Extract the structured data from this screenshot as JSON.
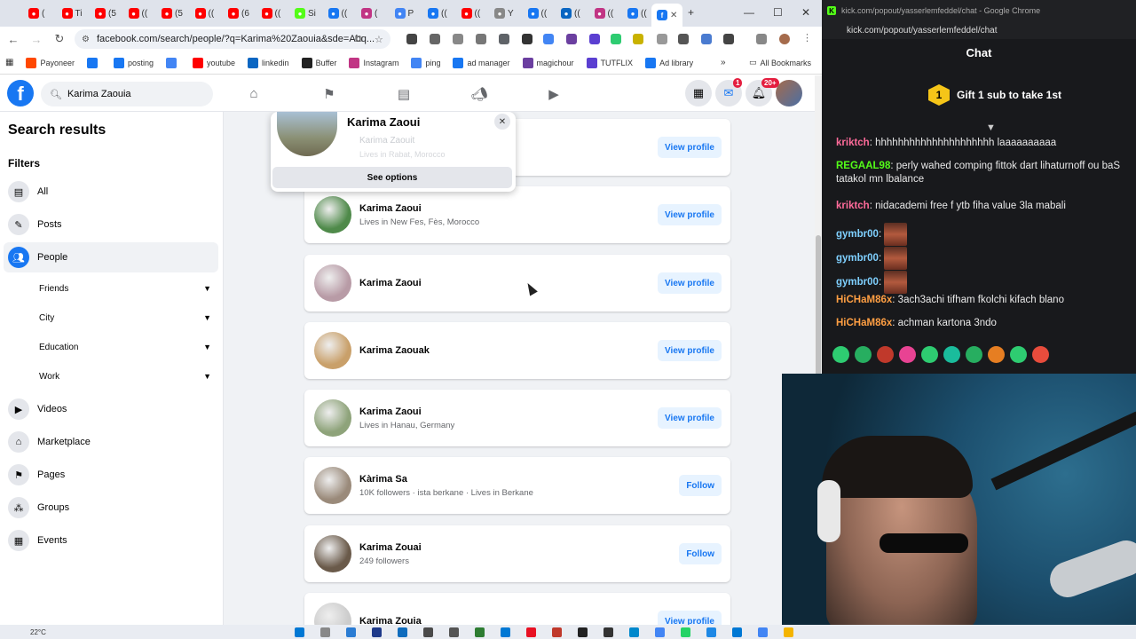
{
  "browser": {
    "tabs": [
      {
        "label": "(",
        "color": "#ff0000"
      },
      {
        "label": "Ti",
        "color": "#ff0000"
      },
      {
        "label": "(5",
        "color": "#ff0000"
      },
      {
        "label": "((",
        "color": "#ff0000"
      },
      {
        "label": "(5",
        "color": "#ff0000"
      },
      {
        "label": "((",
        "color": "#ff0000"
      },
      {
        "label": "(6",
        "color": "#ff0000"
      },
      {
        "label": "((",
        "color": "#ff0000"
      },
      {
        "label": "Si",
        "color": "#53fc18"
      },
      {
        "label": "((",
        "color": "#1877f2"
      },
      {
        "label": "(",
        "color": "#c13584"
      },
      {
        "label": "P",
        "color": "#4285f4"
      },
      {
        "label": "((",
        "color": "#1877f2"
      },
      {
        "label": "((",
        "color": "#ff0000"
      },
      {
        "label": "Y",
        "color": "#888888"
      },
      {
        "label": "((",
        "color": "#1877f2"
      },
      {
        "label": "((",
        "color": "#0a66c2"
      },
      {
        "label": "((",
        "color": "#c13584"
      },
      {
        "label": "((",
        "color": "#1877f2"
      }
    ],
    "new_tab": "+",
    "url": "facebook.com/search/people/?q=Karima%20Zaouia&sde=Abq...",
    "bookmarks": [
      {
        "label": "Payoneer",
        "color": "#ff4800"
      },
      {
        "label": "",
        "color": "#1877f2"
      },
      {
        "label": "posting",
        "color": "#1877f2"
      },
      {
        "label": "",
        "color": "#4285f4"
      },
      {
        "label": "youtube",
        "color": "#ff0000"
      },
      {
        "label": "linkedin",
        "color": "#0a66c2"
      },
      {
        "label": "Buffer",
        "color": "#222222"
      },
      {
        "label": "Instagram",
        "color": "#c13584"
      },
      {
        "label": "ping",
        "color": "#4285f4"
      },
      {
        "label": "ad manager",
        "color": "#1877f2"
      },
      {
        "label": "magichour",
        "color": "#6b3fa0"
      },
      {
        "label": "TUTFLIX",
        "color": "#5b3fd1"
      },
      {
        "label": "Ad library",
        "color": "#1877f2"
      }
    ],
    "more_bookmarks": "»",
    "all_bookmarks": "All Bookmarks"
  },
  "fb": {
    "search_value": "Karima Zaouia",
    "messenger_badge": "1",
    "notif_badge": "20+"
  },
  "sidebar": {
    "title": "Search results",
    "filters_label": "Filters",
    "items": [
      {
        "label": "All",
        "icon": "feed-icon"
      },
      {
        "label": "Posts",
        "icon": "posts-icon"
      },
      {
        "label": "People",
        "icon": "people-icon"
      }
    ],
    "people_sub": [
      "Friends",
      "City",
      "Education",
      "Work"
    ],
    "more_items": [
      {
        "label": "Videos",
        "icon": "video-icon"
      },
      {
        "label": "Marketplace",
        "icon": "marketplace-icon"
      },
      {
        "label": "Pages",
        "icon": "pages-icon"
      },
      {
        "label": "Groups",
        "icon": "groups-icon"
      },
      {
        "label": "Events",
        "icon": "events-icon"
      }
    ]
  },
  "popup": {
    "name": "Karima Zaoui",
    "ghost_name": "Karima Zaouit",
    "ghost_sub": "Lives in Rabat, Morocco",
    "options": "See options"
  },
  "results": [
    {
      "name": "",
      "sub": "",
      "action": "View profile",
      "color": "#7a8a6a"
    },
    {
      "name": "Karima Zaoui",
      "sub": "Lives in New Fes, Fès, Morocco",
      "action": "View profile",
      "color": "#4f8a4a"
    },
    {
      "name": "Karima Zaoui",
      "sub": "",
      "action": "View profile",
      "color": "#b89ba6"
    },
    {
      "name": "Karima Zaouak",
      "sub": "",
      "action": "View profile",
      "color": "#c9a06a"
    },
    {
      "name": "Karima Zaoui",
      "sub": "Lives in Hanau, Germany",
      "action": "View profile",
      "color": "#8ea37a"
    },
    {
      "name": "Kàrima Sa",
      "sub": "10K followers · ista berkane · Lives in Berkane",
      "action": "Follow",
      "color": "#9a8a7a"
    },
    {
      "name": "Karima Zouai",
      "sub": "249 followers",
      "action": "Follow",
      "color": "#6a5a4a"
    },
    {
      "name": "Karima Zouia",
      "sub": "",
      "action": "View profile",
      "color": "#cccccc"
    }
  ],
  "chat": {
    "window_title": "kick.com/popout/yasserlemfeddel/chat - Google Chrome",
    "url": "kick.com/popout/yasserlemfeddel/chat",
    "header": "Chat",
    "gift_number": "1",
    "gift_text": "Gift 1 sub to take 1st",
    "messages": [
      {
        "user": "kriktch",
        "color": "#ff6b9a",
        "text": "hhhhhhhhhhhhhhhhhhhhh laaaaaaaaaa"
      },
      {
        "user": "REGAAL98",
        "color": "#53fc18",
        "text": "perly wahed comping fittok dart lihaturnoff ou baS tatakol mn lbalance"
      },
      {
        "user": "kriktch",
        "color": "#ff6b9a",
        "text": "nidacademi free f ytb fiha value 3la mabali"
      },
      {
        "user": "gymbr00",
        "color": "#7fd0ff",
        "text": ""
      },
      {
        "user": "gymbr00",
        "color": "#7fd0ff",
        "text": ""
      },
      {
        "user": "gymbr00",
        "color": "#7fd0ff",
        "text": ""
      },
      {
        "user": "HiCHaM86x",
        "color": "#ff9f43",
        "text": "3ach3achi tifham fkolchi kifach blano"
      },
      {
        "user": "HiCHaM86x",
        "color": "#ff9f43",
        "text": "achman kartona 3ndo"
      }
    ],
    "emote_colors": [
      "#2ecc71",
      "#27ae60",
      "#c0392b",
      "#e84393",
      "#2ecc71",
      "#1abc9c",
      "#27ae60",
      "#e67e22",
      "#2ecc71",
      "#e74c3c"
    ]
  },
  "taskbar": {
    "weather": "22°C"
  }
}
